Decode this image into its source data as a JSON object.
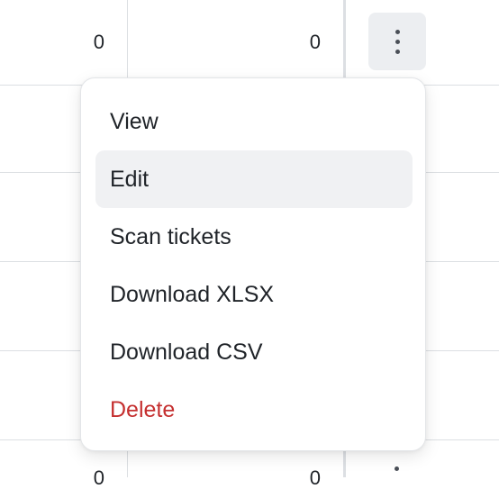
{
  "table": {
    "row1_col1_value": "0",
    "row1_col2_value": "0",
    "last_row_col1_value": "0",
    "last_row_col2_value": "0"
  },
  "menu": {
    "items": [
      {
        "label": "View"
      },
      {
        "label": "Edit"
      },
      {
        "label": "Scan tickets"
      },
      {
        "label": "Download XLSX"
      },
      {
        "label": "Download CSV"
      },
      {
        "label": "Delete"
      }
    ],
    "highlighted_item": "Edit",
    "danger_color": "#c53030"
  },
  "icons": {
    "actions_button": "more-vertical-icon"
  }
}
